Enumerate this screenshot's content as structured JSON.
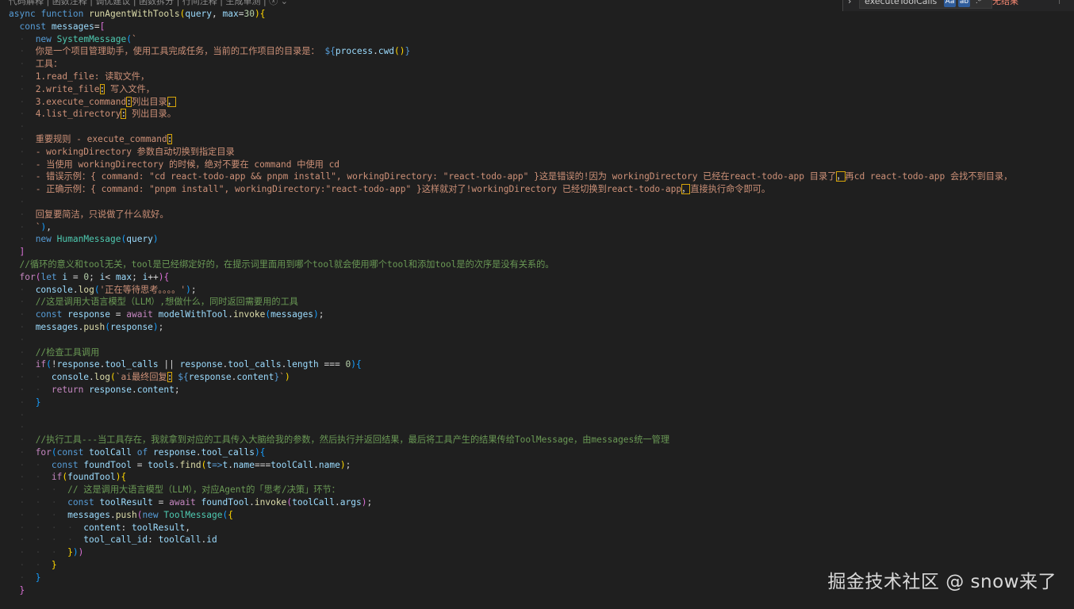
{
  "codelens": "代码解释 | 函数注释 | 调优建议 | 函数拆分 | 行间注释 | 生成单测 | ⓧ ⌄",
  "find_widget": {
    "query": "executeToolCalls",
    "match_case_label": "Aa",
    "whole_word_label": "ab",
    "regex_label": ".*",
    "result": "无结果",
    "prev_icon": "arrow-up-icon"
  },
  "watermark": "掘金技术社区 @ snow来了",
  "code_lines": [
    [
      [
        "kw",
        "async"
      ],
      [
        "txt",
        " "
      ],
      [
        "kw",
        "function"
      ],
      [
        "txt",
        " "
      ],
      [
        "fn",
        "runAgentWithTools"
      ],
      [
        "br",
        "("
      ],
      [
        "var",
        "query"
      ],
      [
        "txt",
        ", "
      ],
      [
        "var",
        "max"
      ],
      [
        "txt",
        "="
      ],
      [
        "num",
        "30"
      ],
      [
        "br",
        ")"
      ],
      [
        "br",
        "{"
      ]
    ],
    [
      [
        "ind",
        "  "
      ],
      [
        "kw",
        "const"
      ],
      [
        "txt",
        " "
      ],
      [
        "var",
        "messages"
      ],
      [
        "txt",
        "="
      ],
      [
        "brp",
        "["
      ]
    ],
    [
      [
        "ind",
        "  ·  "
      ],
      [
        "kw",
        "new"
      ],
      [
        "txt",
        " "
      ],
      [
        "cls",
        "SystemMessage"
      ],
      [
        "brb",
        "("
      ],
      [
        "str",
        "`"
      ]
    ],
    [
      [
        "ind",
        "  ·  "
      ],
      [
        "str",
        "你是一个项目管理助手，使用工具完成任务，当前的工作项目的目录是： "
      ],
      [
        "kw",
        "${"
      ],
      [
        "var",
        "process"
      ],
      [
        "txt",
        "."
      ],
      [
        "var",
        "cwd"
      ],
      [
        "br",
        "()"
      ],
      [
        "kw",
        "}"
      ]
    ],
    [
      [
        "ind",
        "  ·  "
      ],
      [
        "str",
        "工具："
      ]
    ],
    [
      [
        "ind",
        "  ·  "
      ],
      [
        "str",
        "1.read_file: 读取文件，"
      ]
    ],
    [
      [
        "ind",
        "  ·  "
      ],
      [
        "str",
        "2.write_file"
      ],
      [
        "hl",
        ":"
      ],
      [
        "str",
        " 写入文件，"
      ]
    ],
    [
      [
        "ind",
        "  ·  "
      ],
      [
        "str",
        "3.execute_command"
      ],
      [
        "hl",
        ":"
      ],
      [
        "str",
        "列出目录"
      ],
      [
        "hl",
        "，"
      ]
    ],
    [
      [
        "ind",
        "  ·  "
      ],
      [
        "str",
        "4.list_directory"
      ],
      [
        "hl",
        ":"
      ],
      [
        "str",
        " 列出目录。"
      ]
    ],
    [
      [
        "ind",
        "  ·  "
      ]
    ],
    [
      [
        "ind",
        "  ·  "
      ],
      [
        "str",
        "重要规则 - execute_command"
      ],
      [
        "hl",
        ":"
      ]
    ],
    [
      [
        "ind",
        "  ·  "
      ],
      [
        "str",
        "- workingDirectory 参数自动切换到指定目录"
      ]
    ],
    [
      [
        "ind",
        "  ·  "
      ],
      [
        "str",
        "- 当使用 workingDirectory 的时候，绝对不要在 command 中使用 cd"
      ]
    ],
    [
      [
        "ind",
        "  ·  "
      ],
      [
        "str",
        "- 错误示例：{ command: \"cd react-todo-app && pnpm install\", workingDirectory: \"react-todo-app\" }这是错误的!因为 workingDirectory 已经在react-todo-app 目录了"
      ],
      [
        "hl",
        "，"
      ],
      [
        "str",
        "再cd react-todo-app 会找不到目录，"
      ]
    ],
    [
      [
        "ind",
        "  ·  "
      ],
      [
        "str",
        "- 正确示例：{ command: \"pnpm install\", workingDirectory:\"react-todo-app\" }这样就对了!workingDirectory 已经切换到react-todo-app"
      ],
      [
        "hl",
        "，"
      ],
      [
        "str",
        "直接执行命令即可。"
      ]
    ],
    [
      [
        "ind",
        "  ·  "
      ]
    ],
    [
      [
        "ind",
        "  ·  "
      ],
      [
        "str",
        "回复要简洁，只说做了什么就好。"
      ]
    ],
    [
      [
        "ind",
        "  ·  "
      ],
      [
        "str",
        "`"
      ],
      [
        "brb",
        ")"
      ],
      [
        "txt",
        ","
      ]
    ],
    [
      [
        "ind",
        "  ·  "
      ],
      [
        "kw",
        "new"
      ],
      [
        "txt",
        " "
      ],
      [
        "cls",
        "HumanMessage"
      ],
      [
        "brb",
        "("
      ],
      [
        "var",
        "query"
      ],
      [
        "brb",
        ")"
      ]
    ],
    [
      [
        "ind",
        "  "
      ],
      [
        "brp",
        "]"
      ]
    ],
    [
      [
        "ind",
        "  "
      ],
      [
        "cmt",
        "//循环的意义和tool无关，tool是已经绑定好的，在提示词里面用到哪个tool就会使用哪个tool和添加tool是的次序是没有关系的。"
      ]
    ],
    [
      [
        "ind",
        "  "
      ],
      [
        "ctl",
        "for"
      ],
      [
        "brp",
        "("
      ],
      [
        "kw",
        "let"
      ],
      [
        "txt",
        " "
      ],
      [
        "var",
        "i"
      ],
      [
        "txt",
        " = "
      ],
      [
        "num",
        "0"
      ],
      [
        "txt",
        "; "
      ],
      [
        "var",
        "i"
      ],
      [
        "txt",
        "< "
      ],
      [
        "var",
        "max"
      ],
      [
        "txt",
        "; "
      ],
      [
        "var",
        "i"
      ],
      [
        "txt",
        "++"
      ],
      [
        "brp",
        ")"
      ],
      [
        "brp",
        "{"
      ]
    ],
    [
      [
        "ind",
        "  ·  "
      ],
      [
        "var",
        "console"
      ],
      [
        "txt",
        "."
      ],
      [
        "fn",
        "log"
      ],
      [
        "brb",
        "("
      ],
      [
        "str",
        "'正在等待思考。。。。'"
      ],
      [
        "brb",
        ")"
      ],
      [
        "txt",
        ";"
      ]
    ],
    [
      [
        "ind",
        "  ·  "
      ],
      [
        "cmt",
        "//这是调用大语言模型（LLM）,想做什么，同时返回需要用的工具"
      ]
    ],
    [
      [
        "ind",
        "  ·  "
      ],
      [
        "kw",
        "const"
      ],
      [
        "txt",
        " "
      ],
      [
        "var",
        "response"
      ],
      [
        "txt",
        " = "
      ],
      [
        "ctl",
        "await"
      ],
      [
        "txt",
        " "
      ],
      [
        "var",
        "modelWithTool"
      ],
      [
        "txt",
        "."
      ],
      [
        "fn",
        "invoke"
      ],
      [
        "brb",
        "("
      ],
      [
        "var",
        "messages"
      ],
      [
        "brb",
        ")"
      ],
      [
        "txt",
        ";"
      ]
    ],
    [
      [
        "ind",
        "  ·  "
      ],
      [
        "var",
        "messages"
      ],
      [
        "txt",
        "."
      ],
      [
        "fn",
        "push"
      ],
      [
        "brb",
        "("
      ],
      [
        "var",
        "response"
      ],
      [
        "brb",
        ")"
      ],
      [
        "txt",
        ";"
      ]
    ],
    [
      [
        "ind",
        "  ·  "
      ]
    ],
    [
      [
        "ind",
        "  ·  "
      ],
      [
        "cmt",
        "//检查工具调用"
      ]
    ],
    [
      [
        "ind",
        "  ·  "
      ],
      [
        "ctl",
        "if"
      ],
      [
        "brb",
        "("
      ],
      [
        "txt",
        "!"
      ],
      [
        "var",
        "response"
      ],
      [
        "txt",
        "."
      ],
      [
        "var",
        "tool_calls"
      ],
      [
        "txt",
        " || "
      ],
      [
        "var",
        "response"
      ],
      [
        "txt",
        "."
      ],
      [
        "var",
        "tool_calls"
      ],
      [
        "txt",
        "."
      ],
      [
        "var",
        "length"
      ],
      [
        "txt",
        " === "
      ],
      [
        "num",
        "0"
      ],
      [
        "brb",
        ")"
      ],
      [
        "brb",
        "{"
      ]
    ],
    [
      [
        "ind",
        "  ·  ·  "
      ],
      [
        "var",
        "console"
      ],
      [
        "txt",
        "."
      ],
      [
        "fn",
        "log"
      ],
      [
        "br",
        "("
      ],
      [
        "str",
        "`ai最终回复"
      ],
      [
        "hl",
        ":"
      ],
      [
        "str",
        " "
      ],
      [
        "kw",
        "${"
      ],
      [
        "var",
        "response"
      ],
      [
        "txt",
        "."
      ],
      [
        "var",
        "content"
      ],
      [
        "kw",
        "}"
      ],
      [
        "str",
        "`"
      ],
      [
        "br",
        ")"
      ]
    ],
    [
      [
        "ind",
        "  ·  ·  "
      ],
      [
        "ctl",
        "return"
      ],
      [
        "txt",
        " "
      ],
      [
        "var",
        "response"
      ],
      [
        "txt",
        "."
      ],
      [
        "var",
        "content"
      ],
      [
        "txt",
        ";"
      ]
    ],
    [
      [
        "ind",
        "  ·  "
      ],
      [
        "brb",
        "}"
      ]
    ],
    [
      [
        "ind",
        "  ·  "
      ]
    ],
    [
      [
        "ind",
        "  ·  "
      ]
    ],
    [
      [
        "ind",
        "  ·  "
      ],
      [
        "cmt",
        "//执行工具---当工具存在，我就拿到对应的工具传入大脑给我的参数，然后执行并返回结果，最后将工具产生的结果传给ToolMessage，由messages统一管理"
      ]
    ],
    [
      [
        "ind",
        "  ·  "
      ],
      [
        "ctl",
        "for"
      ],
      [
        "brb",
        "("
      ],
      [
        "kw",
        "const"
      ],
      [
        "txt",
        " "
      ],
      [
        "var",
        "toolCall"
      ],
      [
        "txt",
        " "
      ],
      [
        "kw",
        "of"
      ],
      [
        "txt",
        " "
      ],
      [
        "var",
        "response"
      ],
      [
        "txt",
        "."
      ],
      [
        "var",
        "tool_calls"
      ],
      [
        "brb",
        ")"
      ],
      [
        "brb",
        "{"
      ]
    ],
    [
      [
        "ind",
        "  ·  ·  "
      ],
      [
        "kw",
        "const"
      ],
      [
        "txt",
        " "
      ],
      [
        "var",
        "foundTool"
      ],
      [
        "txt",
        " = "
      ],
      [
        "var",
        "tools"
      ],
      [
        "txt",
        "."
      ],
      [
        "fn",
        "find"
      ],
      [
        "br",
        "("
      ],
      [
        "var",
        "t"
      ],
      [
        "kw",
        "=>"
      ],
      [
        "var",
        "t"
      ],
      [
        "txt",
        "."
      ],
      [
        "var",
        "name"
      ],
      [
        "txt",
        "==="
      ],
      [
        "var",
        "toolCall"
      ],
      [
        "txt",
        "."
      ],
      [
        "var",
        "name"
      ],
      [
        "br",
        ")"
      ],
      [
        "txt",
        ";"
      ]
    ],
    [
      [
        "ind",
        "  ·  ·  "
      ],
      [
        "ctl",
        "if"
      ],
      [
        "br",
        "("
      ],
      [
        "var",
        "foundTool"
      ],
      [
        "br",
        ")"
      ],
      [
        "br",
        "{"
      ]
    ],
    [
      [
        "ind",
        "  ·  ·  ·  "
      ],
      [
        "cmt",
        "// 这是调用大语言模型（LLM），对应Agent的「思考/决策」环节："
      ]
    ],
    [
      [
        "ind",
        "  ·  ·  ·  "
      ],
      [
        "kw",
        "const"
      ],
      [
        "txt",
        " "
      ],
      [
        "var",
        "toolResult"
      ],
      [
        "txt",
        " = "
      ],
      [
        "ctl",
        "await"
      ],
      [
        "txt",
        " "
      ],
      [
        "var",
        "foundTool"
      ],
      [
        "txt",
        "."
      ],
      [
        "fn",
        "invoke"
      ],
      [
        "brp",
        "("
      ],
      [
        "var",
        "toolCall"
      ],
      [
        "txt",
        "."
      ],
      [
        "var",
        "args"
      ],
      [
        "brp",
        ")"
      ],
      [
        "txt",
        ";"
      ]
    ],
    [
      [
        "ind",
        "  ·  ·  ·  "
      ],
      [
        "var",
        "messages"
      ],
      [
        "txt",
        "."
      ],
      [
        "fn",
        "push"
      ],
      [
        "brp",
        "("
      ],
      [
        "kw",
        "new"
      ],
      [
        "txt",
        " "
      ],
      [
        "cls",
        "ToolMessage"
      ],
      [
        "brb",
        "("
      ],
      [
        "br",
        "{"
      ]
    ],
    [
      [
        "ind",
        "  ·  ·  ·  ·  "
      ],
      [
        "var",
        "content"
      ],
      [
        "txt",
        ": "
      ],
      [
        "var",
        "toolResult"
      ],
      [
        "txt",
        ","
      ]
    ],
    [
      [
        "ind",
        "  ·  ·  ·  ·  "
      ],
      [
        "var",
        "tool_call_id"
      ],
      [
        "txt",
        ": "
      ],
      [
        "var",
        "toolCall"
      ],
      [
        "txt",
        "."
      ],
      [
        "var",
        "id"
      ]
    ],
    [
      [
        "ind",
        "  ·  ·  ·  "
      ],
      [
        "br",
        "}"
      ],
      [
        "brb",
        ")"
      ],
      [
        "brp",
        ")"
      ]
    ],
    [
      [
        "ind",
        "  ·  ·  "
      ],
      [
        "br",
        "}"
      ]
    ],
    [
      [
        "ind",
        "  ·  "
      ],
      [
        "brb",
        "}"
      ]
    ],
    [
      [
        "ind",
        "  "
      ],
      [
        "brp",
        "}"
      ]
    ],
    [
      [
        "ind",
        "  "
      ]
    ]
  ]
}
